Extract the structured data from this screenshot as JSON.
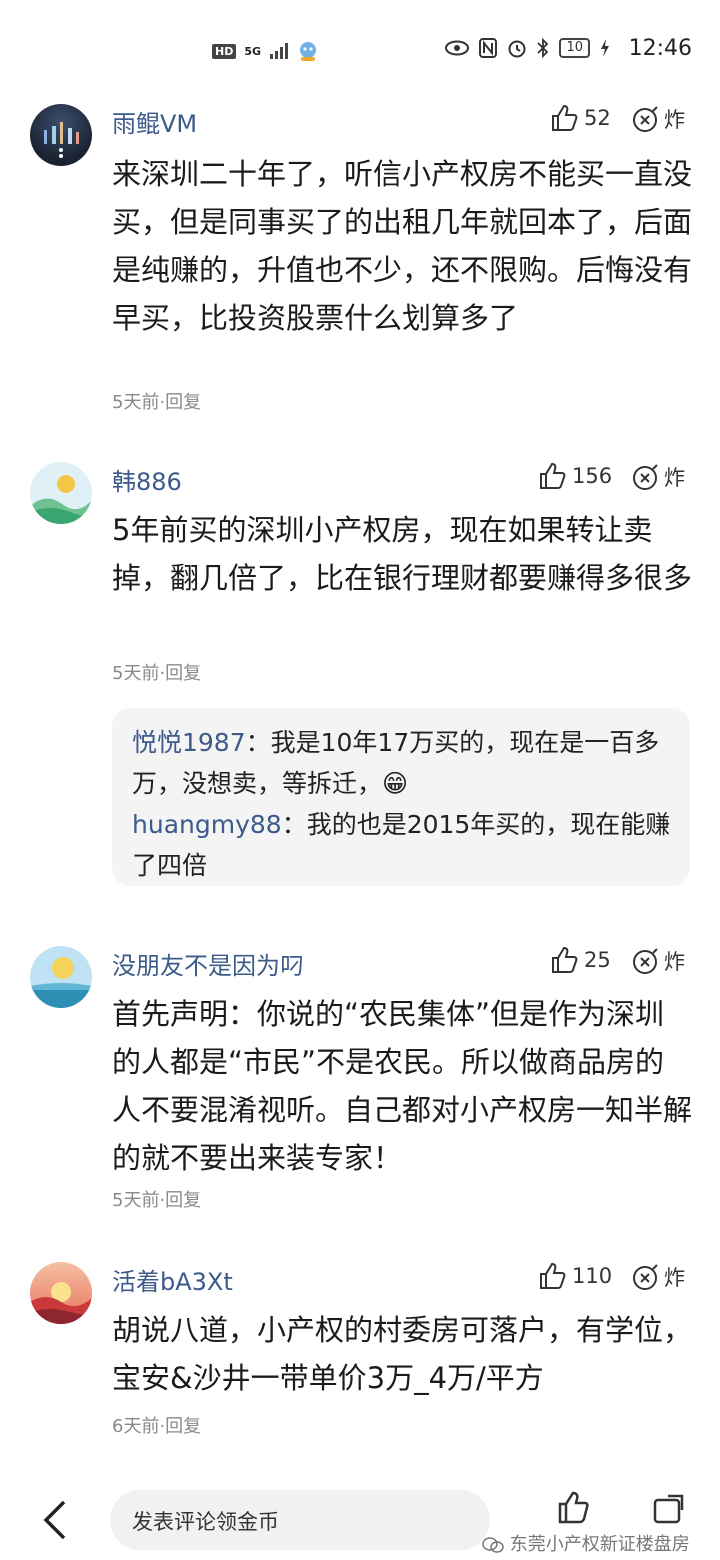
{
  "status_bar": {
    "network": "5G",
    "battery": "10",
    "time": "12:46"
  },
  "comments": [
    {
      "username": "雨鲲VM",
      "likes": "52",
      "boom_label": "炸",
      "text": "来深圳二十年了，听信小产权房不能买一直没买，但是同事买了的出租几年就回本了，后面是纯赚的，升值也不少，还不限购。后悔没有早买，比投资股票什么划算多了",
      "meta": "5天前·回复"
    },
    {
      "username": "韩886",
      "likes": "156",
      "boom_label": "炸",
      "text": "5年前买的深圳小产权房，现在如果转让卖掉，翻几倍了，比在银行理财都要赚得多很多",
      "meta": "5天前·回复",
      "replies": [
        {
          "name": "悦悦1987",
          "text": "：我是10年17万买的，现在是一百多万，没想卖，等拆迁，😁"
        },
        {
          "name": "huangmy88",
          "text": "：我的也是2015年买的，现在能赚了四倍"
        }
      ]
    },
    {
      "username": "没朋友不是因为叼",
      "likes": "25",
      "boom_label": "炸",
      "text": "首先声明：你说的“农民集体”但是作为深圳的人都是“市民”不是农民。所以做商品房的人不要混淆视听。自己都对小产权房一知半解的就不要出来装专家！",
      "meta": "5天前·回复"
    },
    {
      "username": "活着bA3Xt",
      "likes": "110",
      "boom_label": "炸",
      "text": "胡说八道，小产权的村委房可落户，有学位，宝安&沙井一带单价3万_4万/平方",
      "meta": "6天前·回复"
    }
  ],
  "bottom_bar": {
    "comment_placeholder": "发表评论领金币",
    "watermark": "东莞小产权新证楼盘房"
  }
}
